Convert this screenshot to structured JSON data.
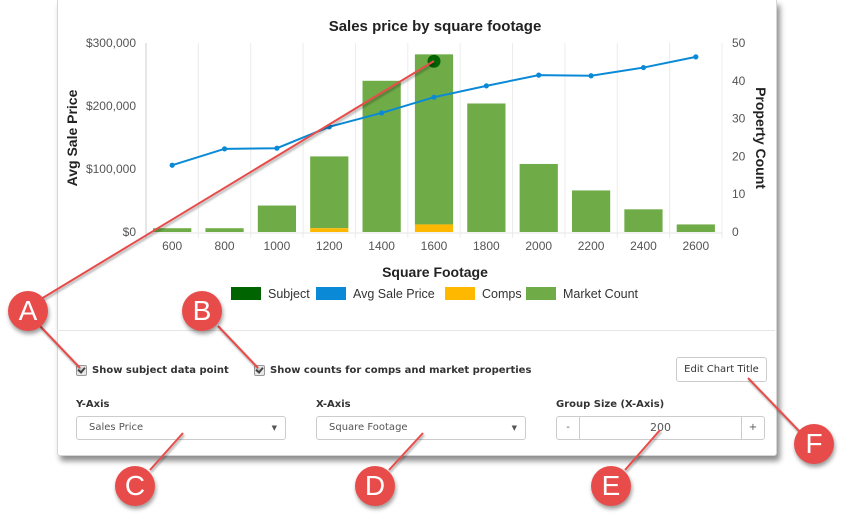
{
  "chart_data": {
    "type": "bar",
    "title": "Sales price by square footage",
    "xlabel": "Square Footage",
    "ylabel": "Avg Sale Price",
    "y2label": "Property Count",
    "categories": [
      "600",
      "800",
      "1000",
      "1200",
      "1400",
      "1600",
      "1800",
      "2000",
      "2200",
      "2400",
      "2600"
    ],
    "ylim": [
      0,
      300000
    ],
    "y2lim": [
      0,
      50
    ],
    "y_ticks": [
      "$0",
      "$100,000",
      "$200,000",
      "$300,000"
    ],
    "y_tick_values": [
      0,
      100000,
      200000,
      300000
    ],
    "y2_ticks": [
      "0",
      "10",
      "20",
      "30",
      "40",
      "50"
    ],
    "y2_tick_values": [
      0,
      10,
      20,
      30,
      40,
      50
    ],
    "grid": true,
    "legend_position": "bottom",
    "series": [
      {
        "name": "Subject",
        "type": "point",
        "color": "#006400",
        "category": "1600",
        "value": 271000
      },
      {
        "name": "Avg Sale Price",
        "type": "line",
        "color": "#0a8ad6",
        "axis": "left",
        "values": [
          106000,
          132000,
          133000,
          167000,
          189000,
          214000,
          232000,
          249000,
          248000,
          261000,
          278000
        ]
      },
      {
        "name": "Comps",
        "type": "bar",
        "color": "#ffb800",
        "axis": "right",
        "values": [
          0,
          0,
          0,
          1,
          0,
          2,
          0,
          0,
          0,
          0,
          0
        ]
      },
      {
        "name": "Market Count",
        "type": "bar",
        "color": "#6fac47",
        "axis": "right",
        "values": [
          1,
          1,
          7,
          20,
          40,
          47,
          34,
          18,
          11,
          6,
          2
        ]
      }
    ]
  },
  "controls": {
    "show_subject_label": "Show subject data point",
    "show_subject_checked": true,
    "show_counts_label": "Show counts for comps and market properties",
    "show_counts_checked": true,
    "edit_title_button": "Edit Chart Title",
    "y_axis_label": "Y-Axis",
    "y_axis_value": "Sales Price",
    "x_axis_label": "X-Axis",
    "x_axis_value": "Square Footage",
    "group_size_label": "Group Size (X-Axis)",
    "group_size_value": "200",
    "minus": "-",
    "plus": "+"
  },
  "callouts": [
    "A",
    "B",
    "C",
    "D",
    "E",
    "F"
  ],
  "icons": {
    "caret": "▼"
  }
}
